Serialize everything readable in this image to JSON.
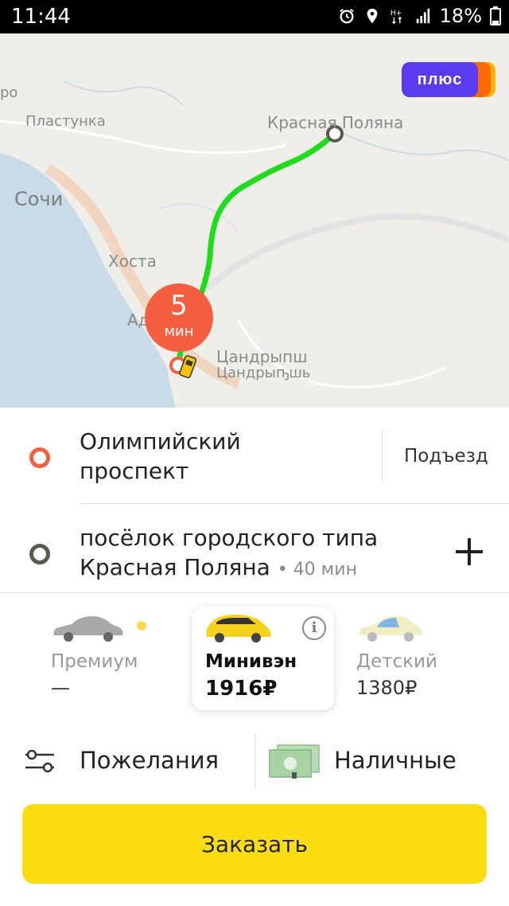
{
  "status_bar": {
    "time": "11:44",
    "icons": [
      "alarm-icon",
      "location-icon",
      "network-h-plus-icon",
      "signal-icon"
    ],
    "battery": "18%"
  },
  "map": {
    "labels": {
      "plastunka": "Пластунка",
      "krasnaya_polyana": "Красная Поляна",
      "sochi": "Сочи",
      "khosta": "Хоста",
      "adler": "Ад",
      "tsandrypsh1": "Цандрыпш",
      "tsandrypsh2": "Цандрыҧшь",
      "edge": "ро"
    },
    "plus_badge": "плюс",
    "eta": {
      "value": "5",
      "unit": "мин"
    },
    "colors": {
      "route": "#1fdc1f",
      "sea": "#c8dbe8",
      "eta": "#f4603f"
    }
  },
  "route": {
    "from": {
      "line1": "Олимпийский",
      "line2": "проспект"
    },
    "entrance_label": "Подъезд",
    "to": {
      "line1": "посёлок городского типа",
      "line2": "Красная Поляна",
      "duration": "• 40 мин"
    }
  },
  "tariffs": [
    {
      "name": "Премиум",
      "price": "—",
      "selected": false
    },
    {
      "name": "Минивэн",
      "price": "1916₽",
      "selected": true
    },
    {
      "name": "Детский",
      "price": "1380₽",
      "selected": false
    }
  ],
  "options": {
    "wishes": "Пожелания",
    "payment": "Наличные"
  },
  "order_button": "Заказать"
}
